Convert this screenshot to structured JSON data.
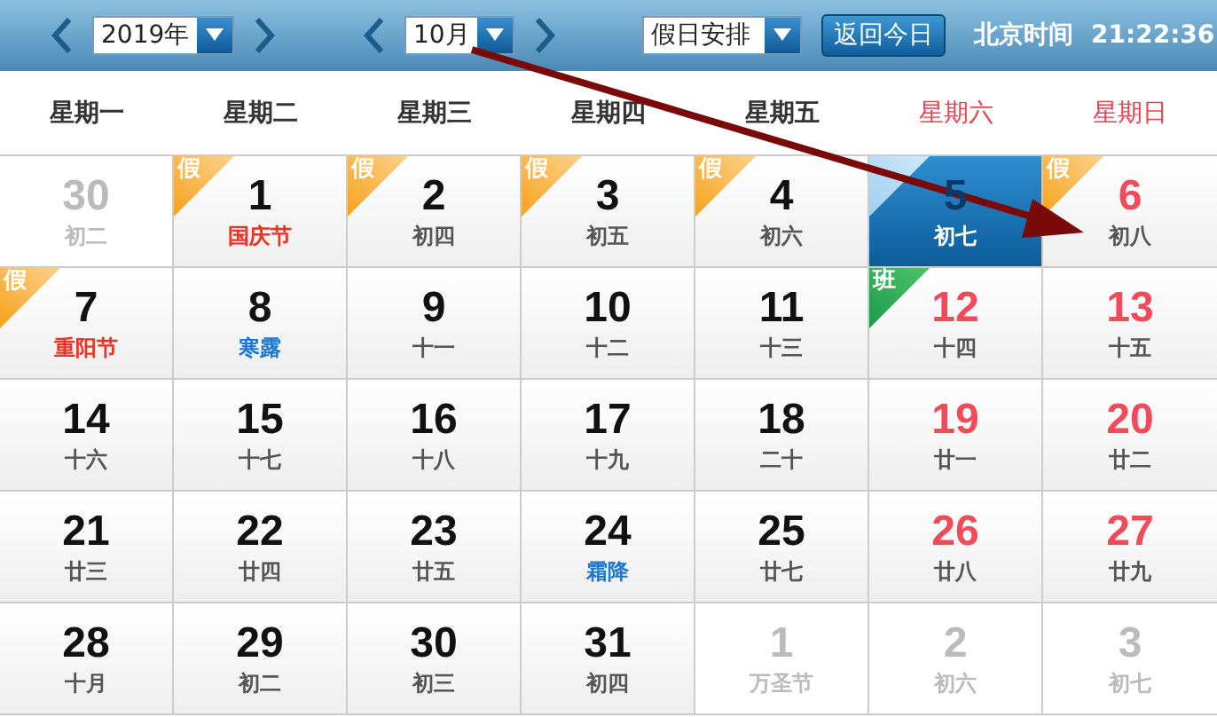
{
  "toolbar": {
    "year_select": "2019年",
    "month_select": "10月",
    "holiday_select": "假日安排",
    "today_button": "返回今日",
    "clock_label": "北京时间",
    "clock_time": "21:22:36"
  },
  "weekdays": [
    {
      "label": "星期一",
      "weekend": false
    },
    {
      "label": "星期二",
      "weekend": false
    },
    {
      "label": "星期三",
      "weekend": false
    },
    {
      "label": "星期四",
      "weekend": false
    },
    {
      "label": "星期五",
      "weekend": false
    },
    {
      "label": "星期六",
      "weekend": true
    },
    {
      "label": "星期日",
      "weekend": true
    }
  ],
  "weeks": [
    [
      {
        "day": "30",
        "lunar": "初二",
        "in_month": false
      },
      {
        "day": "1",
        "lunar": "国庆节",
        "festival": true,
        "in_month": true,
        "weekend": false,
        "today": false,
        "badge": {
          "kind": "holiday",
          "text": "假"
        }
      },
      {
        "day": "2",
        "lunar": "初四",
        "festival": false,
        "solar_term": false,
        "in_month": true,
        "weekend": false,
        "today": false,
        "badge": {
          "kind": "holiday",
          "text": "假"
        }
      },
      {
        "day": "3",
        "lunar": "初五",
        "festival": false,
        "solar_term": false,
        "in_month": true,
        "weekend": false,
        "today": false,
        "badge": {
          "kind": "holiday",
          "text": "假"
        }
      },
      {
        "day": "4",
        "lunar": "初六",
        "festival": false,
        "solar_term": false,
        "in_month": true,
        "weekend": false,
        "today": false,
        "badge": {
          "kind": "holiday",
          "text": "假"
        }
      },
      {
        "day": "5",
        "lunar": "初七",
        "festival": false,
        "solar_term": false,
        "in_month": true,
        "weekend": true,
        "today": true,
        "badge": {
          "kind": "today"
        }
      },
      {
        "day": "6",
        "lunar": "初八",
        "festival": false,
        "solar_term": false,
        "in_month": true,
        "weekend": true,
        "today": false,
        "badge": {
          "kind": "holiday",
          "text": "假"
        }
      }
    ],
    [
      {
        "day": "7",
        "lunar": "重阳节",
        "festival": true,
        "in_month": true,
        "weekend": false,
        "today": false,
        "badge": {
          "kind": "holiday",
          "text": "假"
        }
      },
      {
        "day": "8",
        "lunar": "寒露",
        "festival": false,
        "solar_term": true,
        "in_month": true,
        "weekend": false,
        "today": false
      },
      {
        "day": "9",
        "lunar": "十一",
        "festival": false,
        "solar_term": false,
        "in_month": true,
        "weekend": false,
        "today": false
      },
      {
        "day": "10",
        "lunar": "十二",
        "festival": false,
        "solar_term": false,
        "in_month": true,
        "weekend": false,
        "today": false
      },
      {
        "day": "11",
        "lunar": "十三",
        "festival": false,
        "solar_term": false,
        "in_month": true,
        "weekend": false,
        "today": false
      },
      {
        "day": "12",
        "lunar": "十四",
        "festival": false,
        "solar_term": false,
        "in_month": true,
        "weekend": true,
        "today": false,
        "badge": {
          "kind": "workday",
          "text": "班"
        }
      },
      {
        "day": "13",
        "lunar": "十五",
        "festival": false,
        "solar_term": false,
        "in_month": true,
        "weekend": true,
        "today": false
      }
    ],
    [
      {
        "day": "14",
        "lunar": "十六",
        "festival": false,
        "solar_term": false,
        "in_month": true,
        "weekend": false,
        "today": false
      },
      {
        "day": "15",
        "lunar": "十七",
        "festival": false,
        "solar_term": false,
        "in_month": true,
        "weekend": false,
        "today": false
      },
      {
        "day": "16",
        "lunar": "十八",
        "festival": false,
        "solar_term": false,
        "in_month": true,
        "weekend": false,
        "today": false
      },
      {
        "day": "17",
        "lunar": "十九",
        "festival": false,
        "solar_term": false,
        "in_month": true,
        "weekend": false,
        "today": false
      },
      {
        "day": "18",
        "lunar": "二十",
        "festival": false,
        "solar_term": false,
        "in_month": true,
        "weekend": false,
        "today": false
      },
      {
        "day": "19",
        "lunar": "廿一",
        "festival": false,
        "solar_term": false,
        "in_month": true,
        "weekend": true,
        "today": false
      },
      {
        "day": "20",
        "lunar": "廿二",
        "festival": false,
        "solar_term": false,
        "in_month": true,
        "weekend": true,
        "today": false
      }
    ],
    [
      {
        "day": "21",
        "lunar": "廿三",
        "festival": false,
        "solar_term": false,
        "in_month": true,
        "weekend": false,
        "today": false
      },
      {
        "day": "22",
        "lunar": "廿四",
        "festival": false,
        "solar_term": false,
        "in_month": true,
        "weekend": false,
        "today": false
      },
      {
        "day": "23",
        "lunar": "廿五",
        "festival": false,
        "solar_term": false,
        "in_month": true,
        "weekend": false,
        "today": false
      },
      {
        "day": "24",
        "lunar": "霜降",
        "festival": false,
        "solar_term": true,
        "in_month": true,
        "weekend": false,
        "today": false
      },
      {
        "day": "25",
        "lunar": "廿七",
        "festival": false,
        "solar_term": false,
        "in_month": true,
        "weekend": false,
        "today": false
      },
      {
        "day": "26",
        "lunar": "廿八",
        "festival": false,
        "solar_term": false,
        "in_month": true,
        "weekend": true,
        "today": false
      },
      {
        "day": "27",
        "lunar": "廿九",
        "festival": false,
        "solar_term": false,
        "in_month": true,
        "weekend": true,
        "today": false
      }
    ],
    [
      {
        "day": "28",
        "lunar": "十月",
        "festival": false,
        "solar_term": false,
        "in_month": true,
        "weekend": false,
        "today": false
      },
      {
        "day": "29",
        "lunar": "初二",
        "festival": false,
        "solar_term": false,
        "in_month": true,
        "weekend": false,
        "today": false
      },
      {
        "day": "30",
        "lunar": "初三",
        "festival": false,
        "solar_term": false,
        "in_month": true,
        "weekend": false,
        "today": false
      },
      {
        "day": "31",
        "lunar": "初四",
        "festival": false,
        "solar_term": false,
        "in_month": true,
        "weekend": false,
        "today": false
      },
      {
        "day": "1",
        "lunar": "万圣节",
        "in_month": false
      },
      {
        "day": "2",
        "lunar": "初六",
        "in_month": false
      },
      {
        "day": "3",
        "lunar": "初七",
        "in_month": false
      }
    ]
  ]
}
